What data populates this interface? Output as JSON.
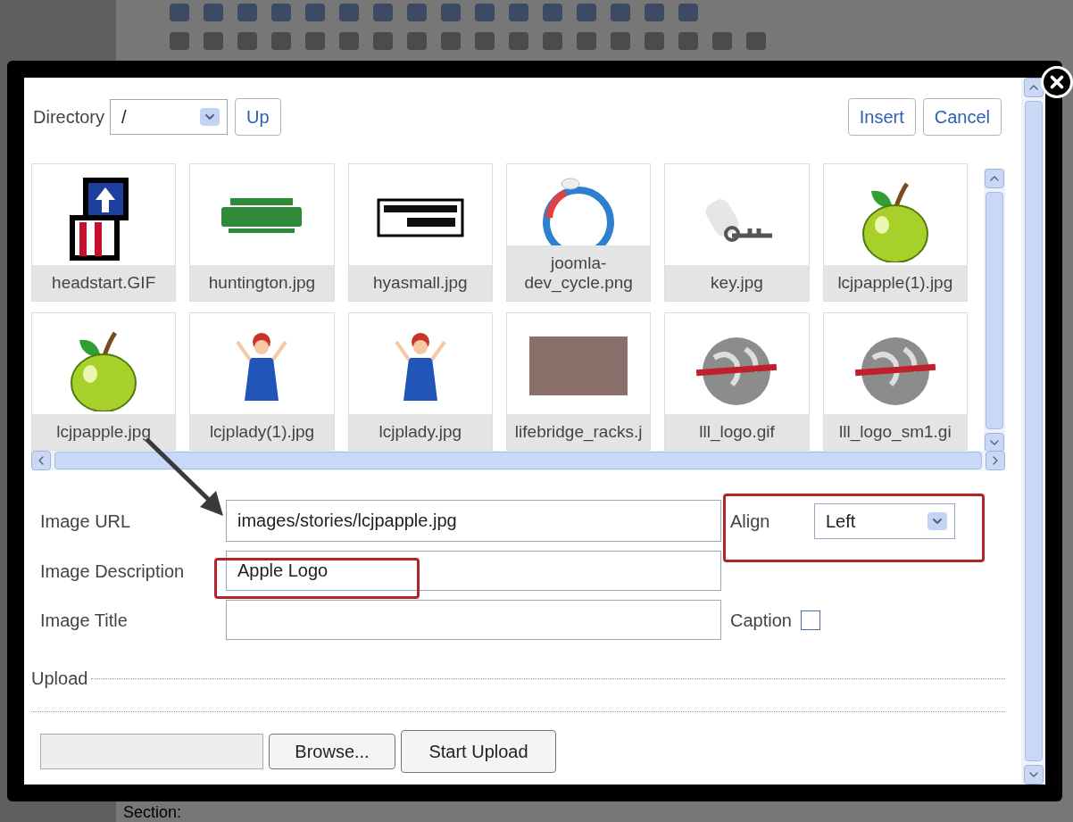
{
  "background_page": {
    "label": "Section:"
  },
  "dialog": {
    "directory": {
      "label": "Directory",
      "value": "/"
    },
    "up_button": "Up",
    "insert_button": "Insert",
    "cancel_button": "Cancel",
    "files": [
      {
        "name": "headstart.GIF",
        "kind": "blocks"
      },
      {
        "name": "huntington.jpg",
        "kind": "banner"
      },
      {
        "name": "hyasmall.jpg",
        "kind": "framed"
      },
      {
        "name": "joomla-dev_cycle.png",
        "kind": "cycle"
      },
      {
        "name": "key.jpg",
        "kind": "key"
      },
      {
        "name": "lcjpapple(1).jpg",
        "kind": "apple"
      },
      {
        "name": "lcjpapple.jpg",
        "kind": "apple"
      },
      {
        "name": "lcjplady(1).jpg",
        "kind": "figure"
      },
      {
        "name": "lcjplady.jpg",
        "kind": "figure"
      },
      {
        "name": "lifebridge_racks.j",
        "kind": "photo"
      },
      {
        "name": "lll_logo.gif",
        "kind": "globe"
      },
      {
        "name": "lll_logo_sm1.gi",
        "kind": "globe"
      }
    ],
    "image_url": {
      "label": "Image URL",
      "value": "images/stories/lcjpapple.jpg"
    },
    "align": {
      "label": "Align",
      "value": "Left"
    },
    "image_description": {
      "label": "Image Description",
      "value": "Apple Logo"
    },
    "image_title": {
      "label": "Image Title"
    },
    "caption": {
      "label": "Caption",
      "checked": false
    },
    "upload": {
      "legend": "Upload",
      "browse_button": "Browse...",
      "start_button": "Start Upload"
    }
  }
}
